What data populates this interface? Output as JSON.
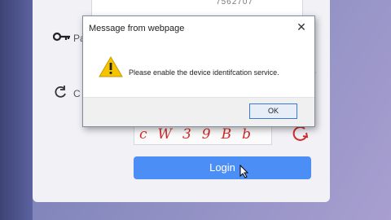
{
  "login": {
    "top_field_value": "7562707",
    "password_label": "Pa",
    "code_label": "C",
    "question_mark": "?",
    "captcha_text": "cW39Bb",
    "login_label": "Login"
  },
  "dialog": {
    "title": "Message from webpage",
    "close_glyph": "✕",
    "message": "Please enable the device identifcation service.",
    "ok_label": "OK"
  },
  "colors": {
    "login_button": "#4b8ef5",
    "captcha_text": "#d22c2c",
    "warning": "#f5c400"
  }
}
